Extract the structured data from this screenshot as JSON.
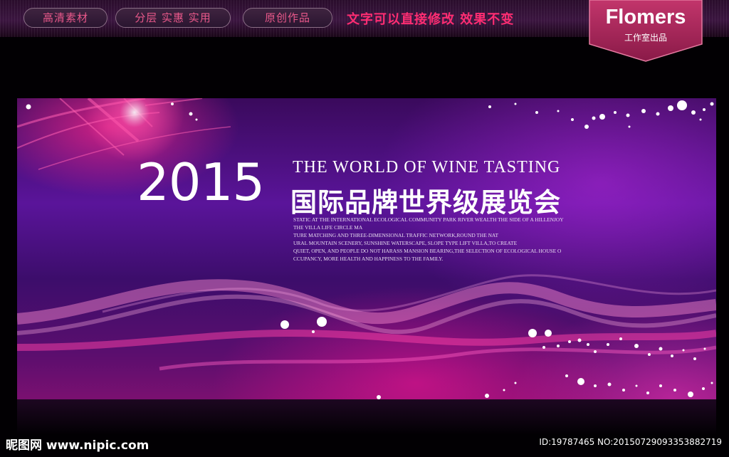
{
  "header": {
    "pills": [
      "高清素材",
      "分层 实惠 实用",
      "原创作品"
    ],
    "slogan": "文字可以直接修改  效果不变",
    "brand_name": "Flomers",
    "brand_sub": "工作室出品"
  },
  "banner": {
    "year": "2015",
    "en_title": "THE WORLD OF WINE TASTING",
    "cn_title": "国际品牌世界级展览会",
    "body_lines": [
      "STATIC AT THE INTERNATIONAL ECOLOGICAL COMMUNITY PARK RIVER WEALTH THE SIDE OF A HILLENJOY",
      "THE VILLA LIFE CIRCLE MA",
      "TURE MATCHING AND THREE-DIMENSIONAL TRAFFIC NETWORK,ROUND THE NAT",
      "URAL MOUNTAIN SCENERY, SUNSHINE WATERSCAPE, SLOPE TYPE LIFT VILLA,TO CREATE",
      "QUIET, OPEN, AND PEOPLE DO NOT HARASS MANSION BEARING,THE SELECTION OF ECOLOGICAL HOUSE O",
      "CCUPANCY, MORE HEALTH AND HAPPINESS TO THE FAMILY."
    ]
  },
  "footer": {
    "site": "昵图网 www.nipic.com",
    "id_text": "ID:19787465 NO:20150729093353882719"
  },
  "colors": {
    "accent_pink": "#ff2d72",
    "pill_text": "#e8588a",
    "brand_bg": "#b02a5e"
  }
}
